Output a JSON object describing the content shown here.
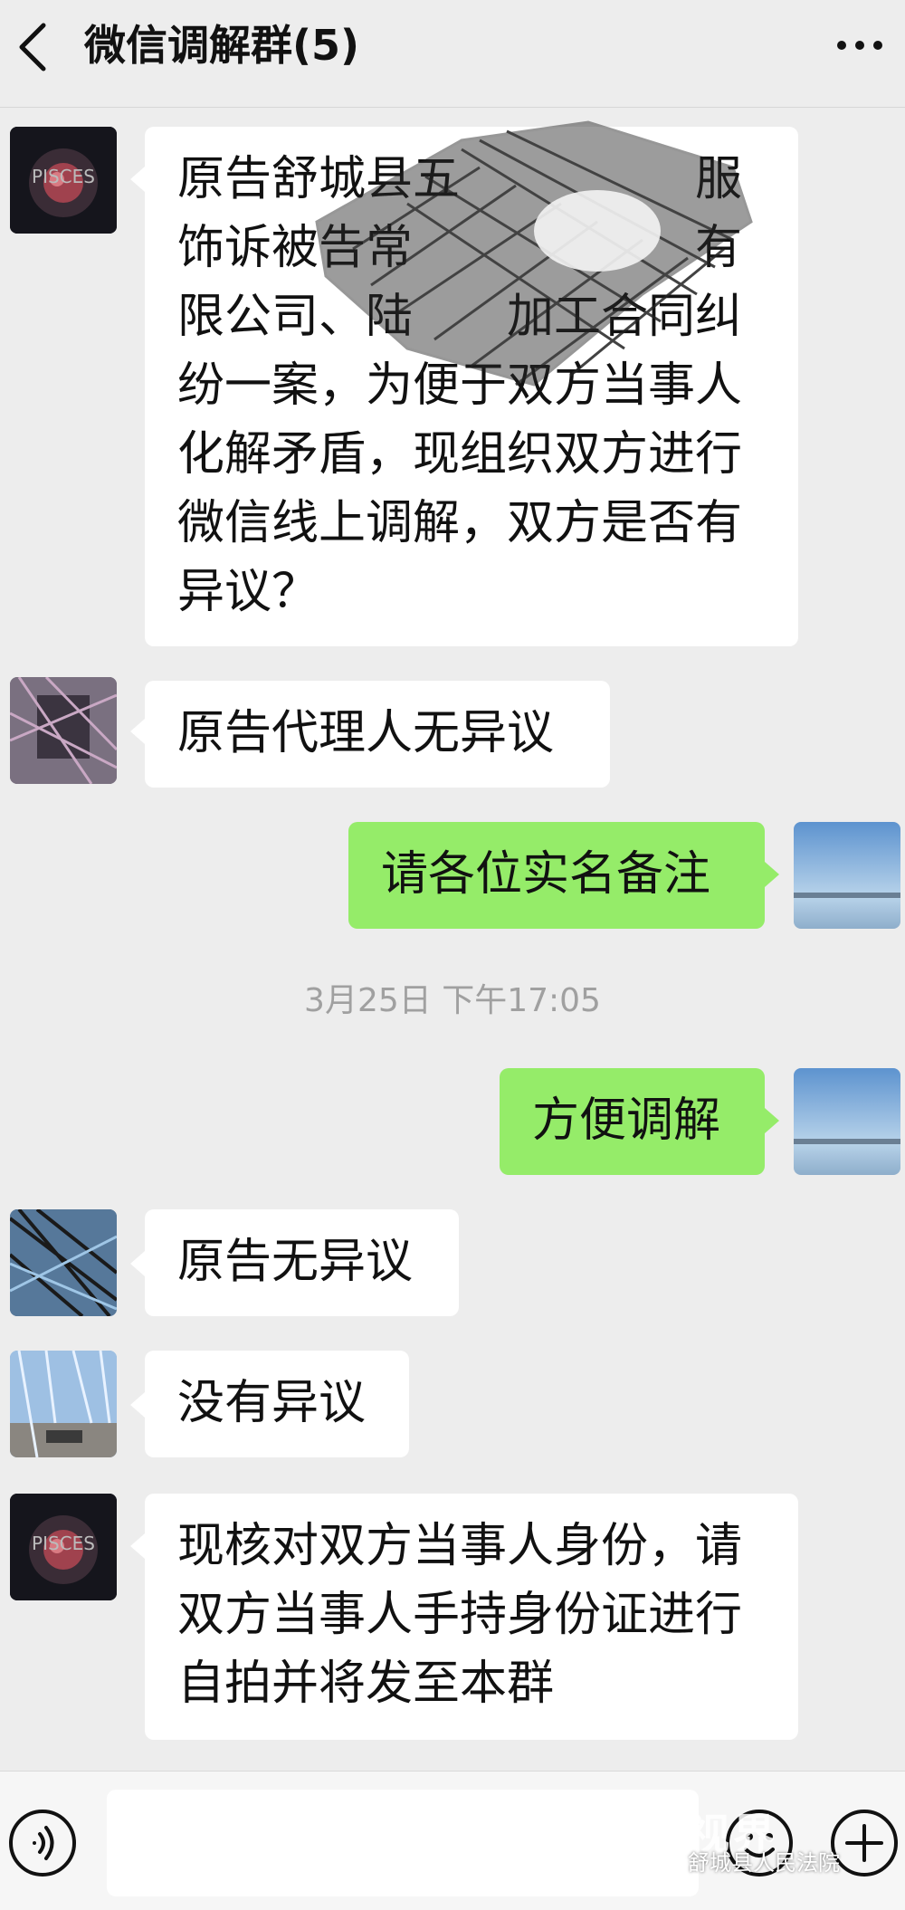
{
  "header": {
    "title": "微信调解群(5)",
    "back_icon": "chevron-left-icon",
    "more_icon": "more-dots-icon"
  },
  "messages": [
    {
      "side": "in",
      "sender_avatar": "avatar-mediator",
      "text": "原告舒城县五　　　　　服饰诉被告常　　　　　　有限公司、陆　　加工合同纠纷一案，为便于双方当事人化解矛盾，现组织双方进行微信线上调解，双方是否有异议？",
      "redacted": true
    },
    {
      "side": "in",
      "sender_avatar": "avatar-plaintiff-agent",
      "text": "原告代理人无异议"
    },
    {
      "side": "out",
      "sender_avatar": "avatar-self",
      "text": "请各位实名备注"
    },
    {
      "side": "out",
      "sender_avatar": "avatar-self",
      "text": "方便调解"
    },
    {
      "side": "in",
      "sender_avatar": "avatar-plaintiff",
      "text": "原告无异议"
    },
    {
      "side": "in",
      "sender_avatar": "avatar-defendant",
      "text": "没有异议"
    },
    {
      "side": "in",
      "sender_avatar": "avatar-mediator",
      "text": "现核对双方当事人身份，请双方当事人手持身份证进行自拍并将发至本群"
    }
  ],
  "timestamp": "3月25日 下午17:05",
  "avatar_text": "PISCES",
  "input_bar": {
    "voice_icon": "voice-icon",
    "emoji_icon": "emoji-icon",
    "plus_icon": "plus-icon",
    "placeholder": ""
  },
  "watermark": {
    "logo": "视界",
    "text": "舒城县人民法院"
  },
  "colors": {
    "background": "#ededed",
    "outgoing_bubble": "#95ec69",
    "incoming_bubble": "#ffffff",
    "timestamp": "#a0a0a0"
  }
}
